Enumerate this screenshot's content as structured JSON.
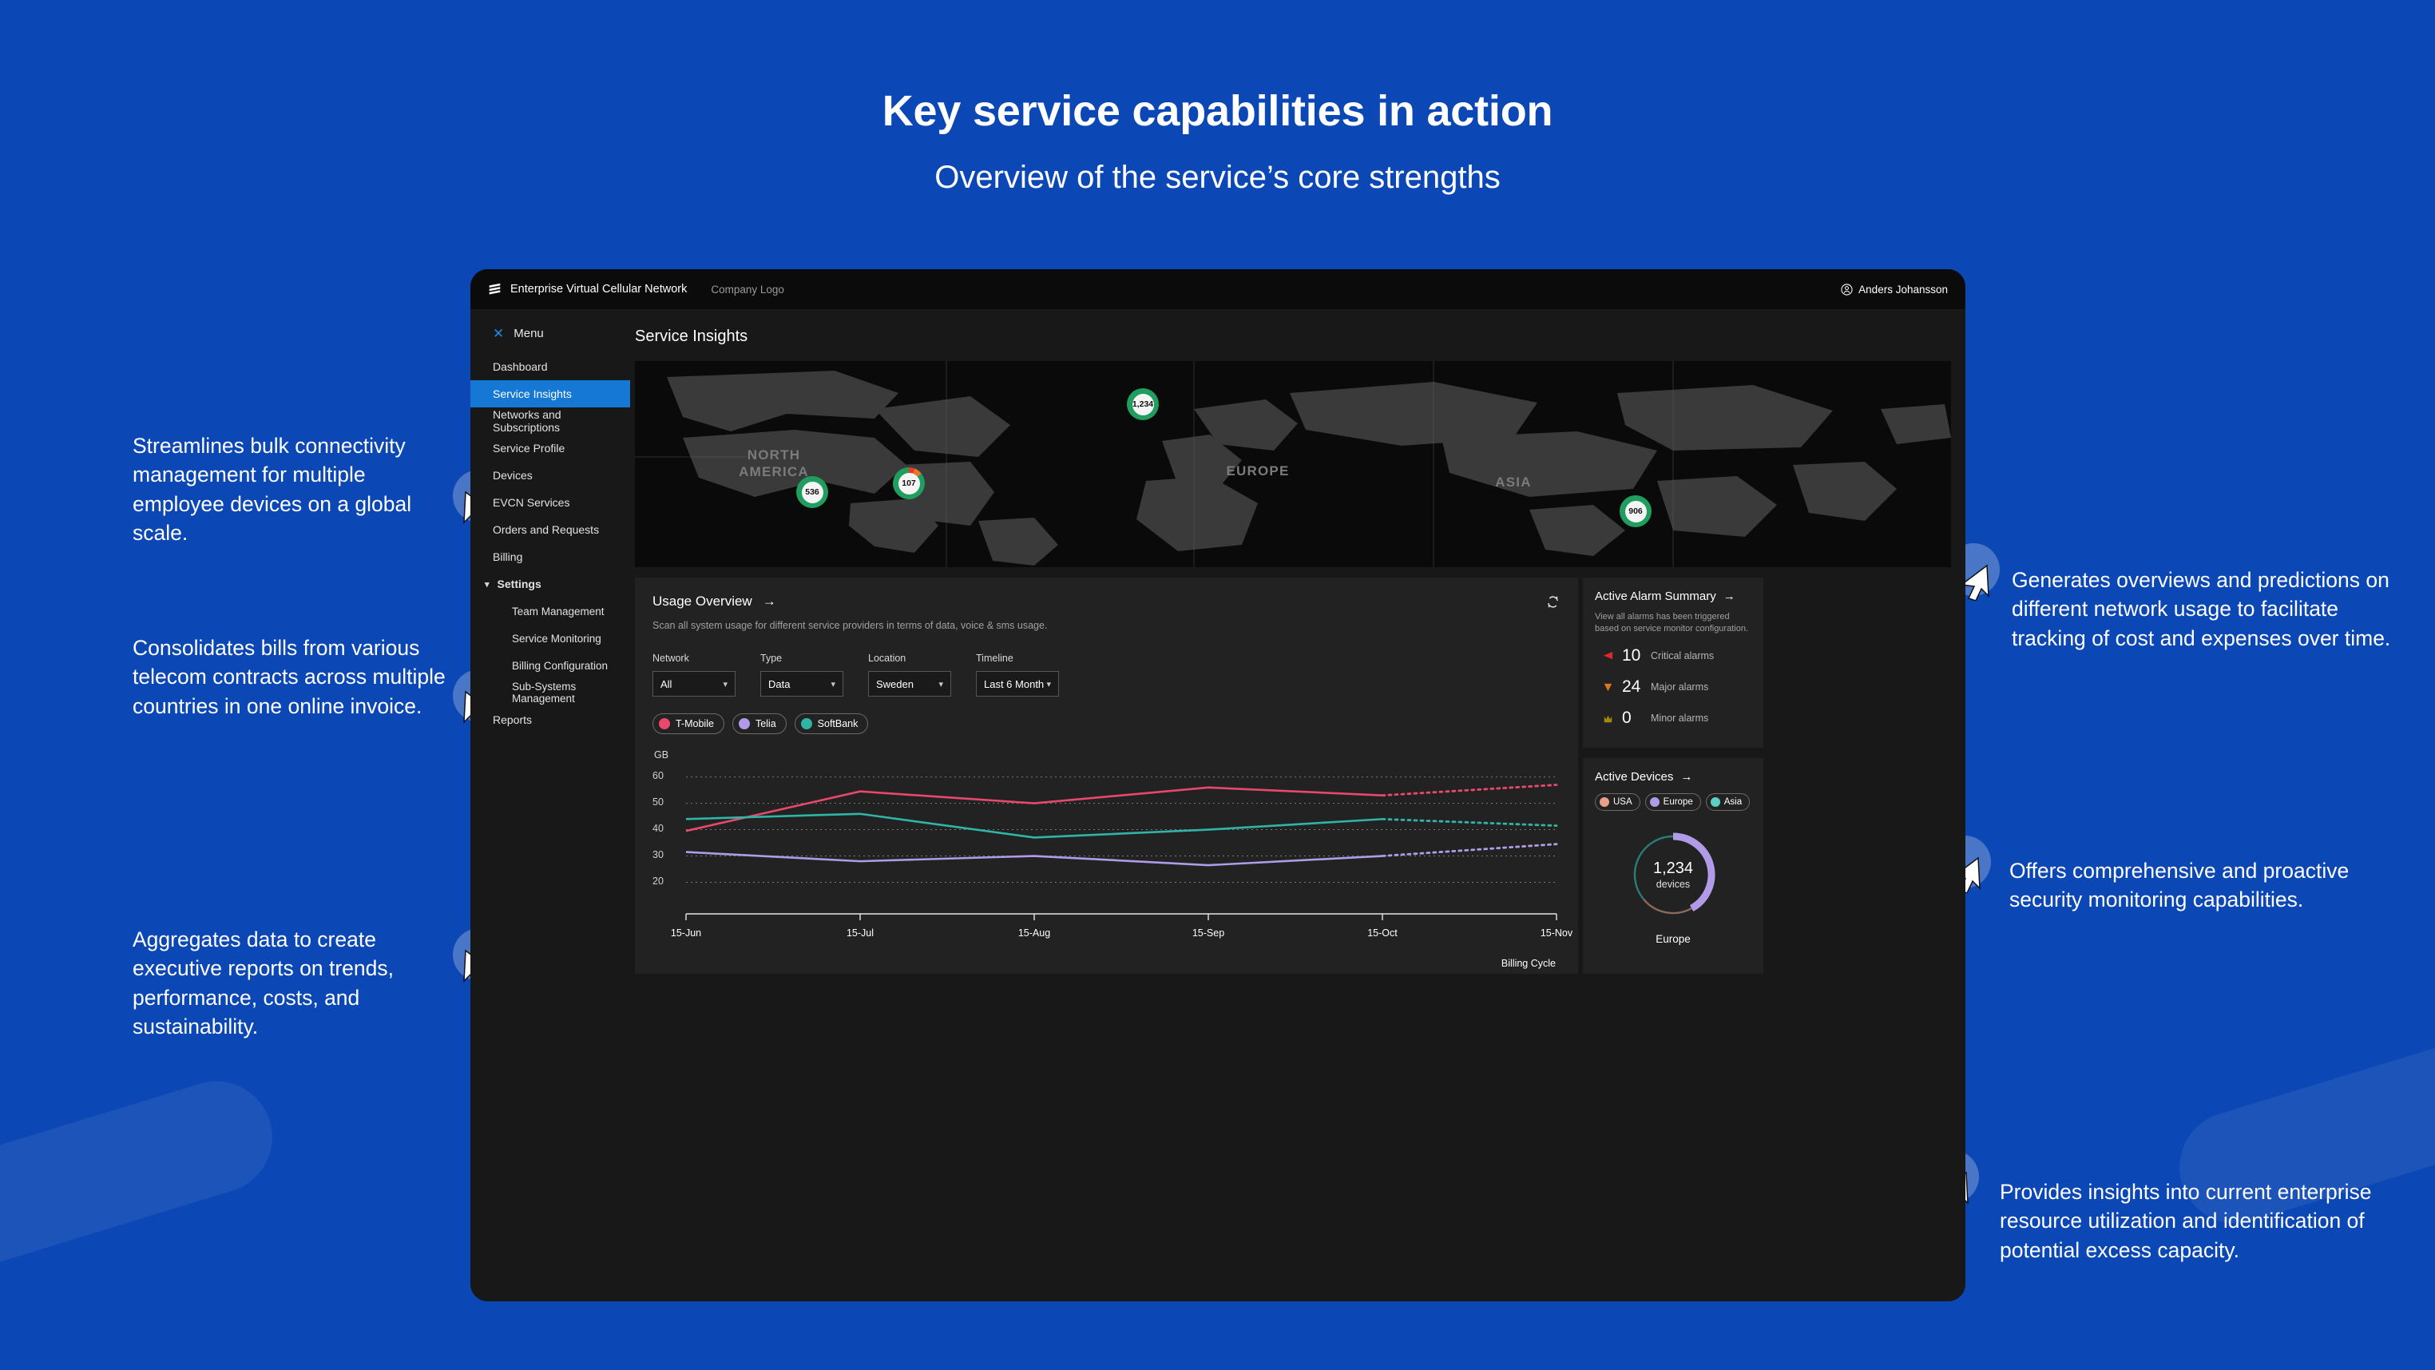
{
  "slide": {
    "title": "Key service capabilities in action",
    "subtitle": "Overview of the service’s core strengths",
    "background_color": "#0b47b5"
  },
  "annotations": [
    {
      "id": "bulk-connectivity",
      "text": "Streamlines bulk connectivity management for multiple employee devices on a global scale."
    },
    {
      "id": "consolidated-billing",
      "text": "Consolidates bills from various telecom contracts across multiple countries in one online invoice."
    },
    {
      "id": "executive-reports",
      "text": "Aggregates data to create executive reports on trends, performance, costs, and sustainability."
    },
    {
      "id": "usage-predictions",
      "text": "Generates overviews and predictions on different network usage to facilitate tracking of cost and expenses over time."
    },
    {
      "id": "security-monitoring",
      "text": "Offers comprehensive and proactive security monitoring capabilities."
    },
    {
      "id": "resource-utilization",
      "text": "Provides insights into current enterprise resource utilization and identification of potential excess capacity."
    }
  ],
  "app": {
    "topbar": {
      "logo_icon": "ericsson-logo-icon",
      "brand": "Enterprise Virtual Cellular Network",
      "company_logo": "Company Logo",
      "user_icon": "user-avatar-icon",
      "user_name": "Anders Johansson"
    },
    "sidebar": {
      "close_icon": "close-icon",
      "menu_label": "Menu",
      "items": [
        {
          "label": "Dashboard",
          "active": false,
          "level": 0
        },
        {
          "label": "Service Insights",
          "active": true,
          "level": 0
        },
        {
          "label": "Networks and Subscriptions",
          "active": false,
          "level": 0
        },
        {
          "label": "Service Profile",
          "active": false,
          "level": 0
        },
        {
          "label": "Devices",
          "active": false,
          "level": 0
        },
        {
          "label": "EVCN Services",
          "active": false,
          "level": 0
        },
        {
          "label": "Orders and Requests",
          "active": false,
          "level": 0
        },
        {
          "label": "Billing",
          "active": false,
          "level": 0
        },
        {
          "label": "Settings",
          "active": false,
          "level": 0,
          "group": true,
          "chevron": "⌄"
        },
        {
          "label": "Team Management",
          "active": false,
          "level": 1
        },
        {
          "label": "Service Monitoring",
          "active": false,
          "level": 1
        },
        {
          "label": "Billing Configuration",
          "active": false,
          "level": 1
        },
        {
          "label": "Sub-Systems Management",
          "active": false,
          "level": 1
        },
        {
          "label": "Reports",
          "active": false,
          "level": 0
        }
      ]
    },
    "page_title": "Service Insights",
    "map": {
      "continent_labels": [
        {
          "id": "north-america",
          "text": "NORTH AMERICA"
        },
        {
          "id": "europe",
          "text": "EUROPE"
        },
        {
          "id": "asia",
          "text": "ASIA"
        }
      ],
      "pins": [
        {
          "id": "usa-west",
          "value": "536",
          "status": "healthy"
        },
        {
          "id": "usa-east",
          "value": "107",
          "status": "mixed"
        },
        {
          "id": "europe",
          "value": "1,234",
          "status": "healthy"
        },
        {
          "id": "asia",
          "value": "906",
          "status": "healthy"
        }
      ],
      "colors": {
        "healthy": "#1f9e5f",
        "major": "#e8762a",
        "critical": "#e03b2c"
      }
    },
    "usage": {
      "title": "Usage Overview",
      "arrow": "→",
      "refresh_icon": "refresh-icon",
      "description": "Scan all system usage for different service providers in terms of data, voice & sms usage.",
      "filters": [
        {
          "label": "Network",
          "value": "All",
          "chevron": "⌄"
        },
        {
          "label": "Type",
          "value": "Data",
          "chevron": "⌄"
        },
        {
          "label": "Location",
          "value": "Sweden",
          "chevron": "⌄"
        },
        {
          "label": "Timeline",
          "value": "Last 6 Month",
          "chevron": "⌄"
        }
      ],
      "legend": [
        {
          "label": "T-Mobile",
          "color": "#e8486b"
        },
        {
          "label": "Telia",
          "color": "#b09be8"
        },
        {
          "label": "SoftBank",
          "color": "#2fb5a8"
        }
      ]
    },
    "alarms": {
      "title": "Active Alarm Summary",
      "arrow": "→",
      "description": "View all alarms has been triggered based on service monitor configuration.",
      "rows": [
        {
          "icon": "critical-flag-icon",
          "count": "10",
          "label": "Critical alarms",
          "color": "#e0262f"
        },
        {
          "icon": "major-flag-icon",
          "count": "24",
          "label": "Major alarms",
          "color": "#e2761d"
        },
        {
          "icon": "minor-flag-icon",
          "count": "0",
          "label": "Minor alarms",
          "color": "#a6890c"
        }
      ]
    },
    "devices": {
      "title": "Active Devices",
      "arrow": "→",
      "regions": [
        {
          "label": "USA",
          "color": "#e8a189"
        },
        {
          "label": "Europe",
          "color": "#b09be8"
        },
        {
          "label": "Asia",
          "color": "#5ccfc4"
        }
      ],
      "value": "1,234",
      "unit": "devices",
      "caption": "Europe"
    }
  },
  "chart_data": {
    "type": "line",
    "title": "Usage Overview",
    "xlabel": "Billing Cycle",
    "ylabel": "GB",
    "ylim": [
      15,
      62
    ],
    "yticks": [
      20,
      30,
      40,
      50,
      60
    ],
    "grid": true,
    "legend_position": "top-left",
    "categories": [
      "15-Jun",
      "15-Jul",
      "15-Aug",
      "15-Sep",
      "15-Oct",
      "15-Nov"
    ],
    "note": "Solid segments are actuals (15-Jun through 15-Oct); dotted segments from 15-Oct to 15-Nov are forecast.",
    "series": [
      {
        "name": "T-Mobile",
        "color": "#e8486b",
        "values": [
          39.5,
          54.5,
          50.0,
          56.0,
          53.0,
          57.0
        ],
        "forecast_from": "15-Oct"
      },
      {
        "name": "SoftBank",
        "color": "#2fb5a8",
        "values": [
          44.0,
          46.0,
          37.0,
          40.0,
          44.0,
          41.5
        ],
        "forecast_from": "15-Oct"
      },
      {
        "name": "Telia",
        "color": "#b09be8",
        "values": [
          31.5,
          28.0,
          30.0,
          26.5,
          30.0,
          34.5
        ],
        "forecast_from": "15-Oct"
      }
    ]
  },
  "donut_data": {
    "type": "pie",
    "title": "Active Devices",
    "center_value": "1,234",
    "center_unit": "devices",
    "caption": "Europe",
    "slices": [
      {
        "name": "Europe",
        "color": "#b09be8",
        "percent": 42
      },
      {
        "name": "USA",
        "color": "#8a6a5c",
        "percent": 22
      },
      {
        "name": "Asia",
        "color": "#2d7b75",
        "percent": 36
      }
    ]
  }
}
